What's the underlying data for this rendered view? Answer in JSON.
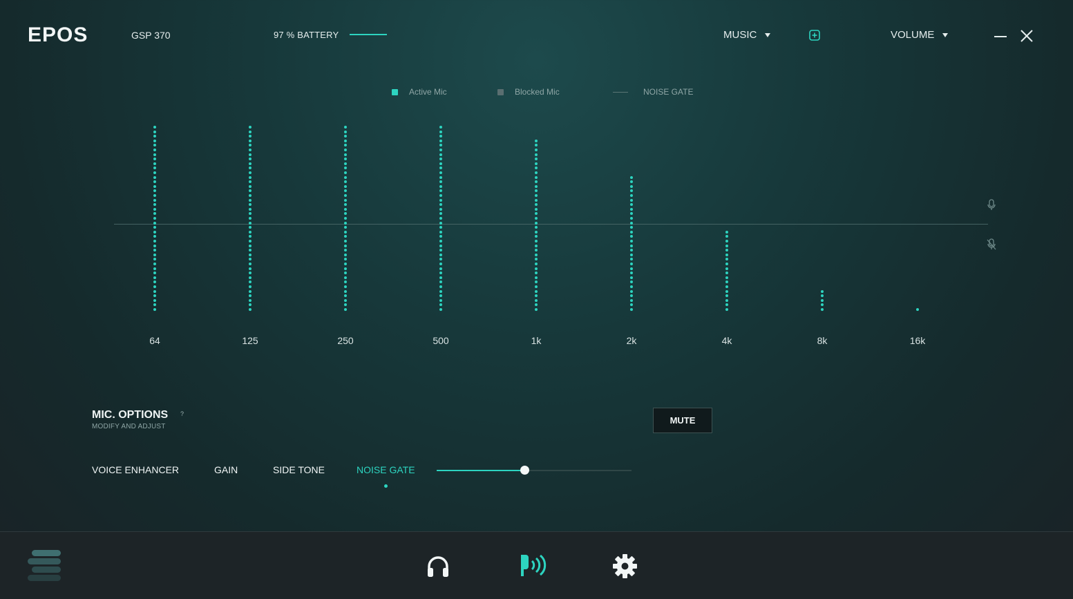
{
  "header": {
    "logo": "EPOS",
    "device": "GSP 370",
    "battery": {
      "label": "97 % BATTERY",
      "level": 0.97
    },
    "preset_dropdown": "MUSIC",
    "volume_dropdown": "VOLUME"
  },
  "legend": {
    "active": "Active Mic",
    "blocked": "Blocked Mic",
    "gate": "NOISE GATE"
  },
  "colors": {
    "accent": "#2dd4c0",
    "blocked": "#5a6e70",
    "background": "#17393b",
    "bottom_bar": "#1d2427"
  },
  "chart_data": {
    "type": "bar",
    "categories": [
      "64",
      "125",
      "250",
      "500",
      "1k",
      "2k",
      "4k",
      "8k",
      "16k"
    ],
    "values": [
      100,
      100,
      100,
      100,
      93,
      73,
      45,
      12,
      2
    ],
    "ylim": [
      0,
      100
    ],
    "noise_gate_level": 47
  },
  "mic_options": {
    "title": "MIC. OPTIONS",
    "help": "?",
    "subtitle": "MODIFY AND ADJUST",
    "mute_label": "MUTE",
    "tabs": [
      "VOICE ENHANCER",
      "GAIN",
      "SIDE TONE",
      "NOISE GATE"
    ],
    "active_tab": "NOISE GATE",
    "noise_gate_slider": 0.45
  },
  "bottom_nav": {
    "items": [
      "menu-icon",
      "headphones-icon",
      "microphone-icon",
      "settings-icon"
    ],
    "active": "microphone-icon"
  }
}
